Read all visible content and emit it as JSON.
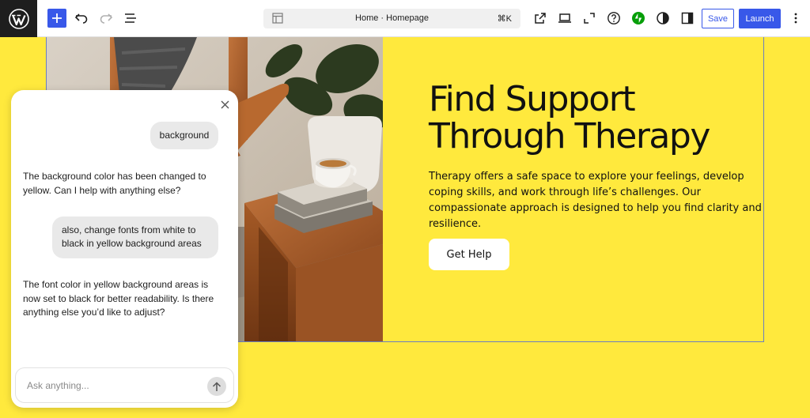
{
  "toolbar": {
    "logo_icon": "wordpress-logo",
    "add_icon": "plus-icon",
    "undo_icon": "undo-icon",
    "redo_icon": "redo-icon",
    "list_view_icon": "list-view-icon",
    "document_title": "Home · Homepage",
    "shortcut": "⌘K",
    "view_icons": [
      "external-link-icon",
      "desktop-preview-icon",
      "fullscreen-icon",
      "help-icon",
      "jetpack-icon",
      "styles-icon",
      "sidebar-icon"
    ],
    "save_label": "Save",
    "launch_label": "Launch",
    "more_icon": "more-vertical-icon",
    "accent_color": "#3858e9"
  },
  "hero": {
    "title_line1": "Find Support",
    "title_line2": "Through Therapy",
    "description": "Therapy offers a safe space to explore your feelings, develop coping skills, and work through life’s challenges. Our compassionate approach is designed to help you find clarity and resilience.",
    "button_label": "Get Help",
    "background_color": "#ffe93d"
  },
  "chat": {
    "messages": [
      {
        "role": "user",
        "text": "background"
      },
      {
        "role": "assistant",
        "text": "The background color has been changed to yellow. Can I help with anything else?"
      },
      {
        "role": "user",
        "text": "also, change fonts from white to black in yellow background areas"
      },
      {
        "role": "assistant",
        "text": "The font color in yellow background areas is now set to black for better readability. Is there anything else you’d like to adjust?"
      }
    ],
    "input_placeholder": "Ask anything..."
  }
}
